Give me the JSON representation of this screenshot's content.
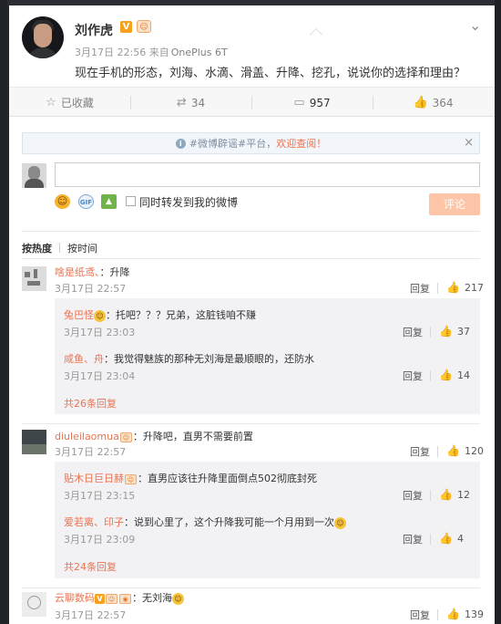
{
  "post": {
    "author": "刘作虎",
    "verified_badge": "V",
    "vip_badge": "🐸",
    "close": "⌄",
    "date": "3月17日 22:56",
    "source_prefix": "来自",
    "source": "OnePlus 6T",
    "text": "现在手机的形态，刘海、水滴、滑盖、升降、挖孔，说说你的选择和理由？"
  },
  "actions": {
    "favorite": "已收藏",
    "repost": "34",
    "comment": "957",
    "like": "364"
  },
  "notice": {
    "prefix": "#微博辟谣#平台，",
    "link": "欢迎查阅！",
    "close": "×"
  },
  "reply_box": {
    "value": "",
    "also_repost": "同时转发到我的微博",
    "submit": "评论"
  },
  "sort": {
    "hot": "按热度",
    "time": "按时间"
  },
  "comments": [
    {
      "user": "啥是纸鸢、",
      "text": "：升降",
      "time": "3月17日 22:57",
      "reply": "回复",
      "likes": "217",
      "replies": [
        {
          "user": "兔巴怪",
          "text": "：托吧？？？兄弟，这脏钱咱不赚",
          "time": "3月17日 23:03",
          "reply": "回复",
          "likes": "37"
        },
        {
          "user": "咸鱼、舟",
          "text": "：我觉得魅族的那种无刘海是最顺眼的，还防水",
          "time": "3月17日 23:04",
          "reply": "回复",
          "likes": "14"
        }
      ],
      "more": "共26条回复"
    },
    {
      "user": "diuleilaomua",
      "text": "：升降吧，直男不需要前置",
      "time": "3月17日 22:57",
      "reply": "回复",
      "likes": "120",
      "replies": [
        {
          "user": "贴木日巨日赫",
          "text": "：直男应该往升降里面倒点502彻底封死",
          "time": "3月17日 23:15",
          "reply": "回复",
          "likes": "12"
        },
        {
          "user": "爱若离、印子",
          "text": "：说到心里了，这个升降我可能一个月用到一次",
          "time": "3月17日 23:09",
          "reply": "回复",
          "likes": "4"
        }
      ],
      "more": "共24条回复"
    },
    {
      "user": "云聊数码",
      "text": "：无刘海",
      "time": "3月17日 22:57",
      "reply": "回复",
      "likes": "139"
    }
  ]
}
